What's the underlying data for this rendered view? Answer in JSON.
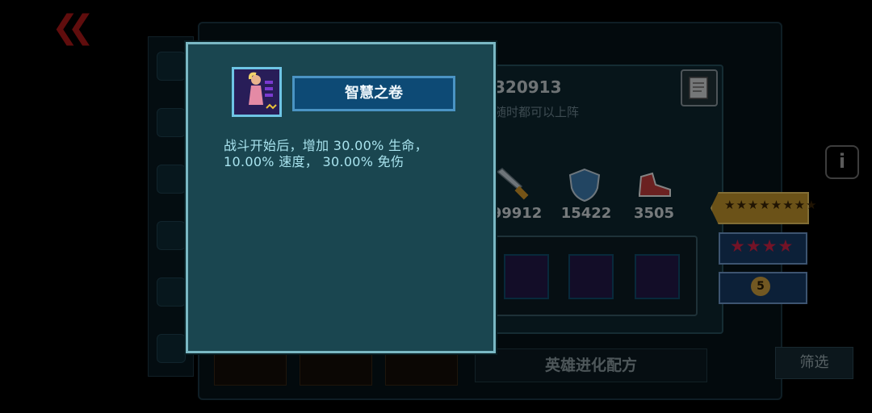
{
  "nav": {
    "back_icon": "double-chevron-left-icon"
  },
  "hero": {
    "id_number": "320913",
    "subtitle": "随时都可以上阵",
    "stats": [
      {
        "icon": "sword-icon",
        "value": "99912"
      },
      {
        "icon": "shield-icon",
        "value": "15422"
      },
      {
        "icon": "sneaker-icon",
        "value": "3505"
      }
    ],
    "star_rank_stars": "★★★★★★★★",
    "red_stars": "★★★★",
    "level": "5"
  },
  "popup": {
    "title": "智慧之卷",
    "description": "战斗开始后，增加 30.00% 生命， 10.00% 速度， 30.00% 免伤"
  },
  "buttons": {
    "evolve": "英雄进化配方",
    "filter": "筛选",
    "info": "i"
  },
  "colors": {
    "popup_bg": "#1a4650",
    "popup_border": "#7ab8c4",
    "title_bar": "#0d4a75",
    "desc_text": "#a9e4ef"
  }
}
